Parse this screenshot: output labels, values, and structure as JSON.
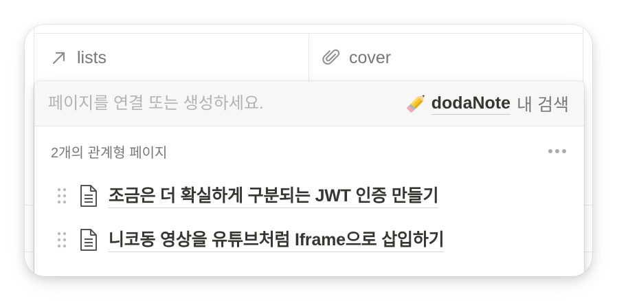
{
  "table": {
    "columns": [
      {
        "icon": "arrow-up-right-icon",
        "label": "lists"
      },
      {
        "icon": "paperclip-icon",
        "label": "cover"
      }
    ]
  },
  "popover": {
    "search": {
      "placeholder": "페이지를 연결 또는 생성하세요.",
      "value": ""
    },
    "scope": {
      "emoji": "pencil-emoji",
      "database": "dodaNote",
      "suffix": "내 검색"
    },
    "section": {
      "title": "2개의 관계형 페이지",
      "more_icon": "more-horizontal-icon"
    },
    "pages": [
      {
        "icon": "document-icon",
        "title": "조금은 더 확실하게 구분되는 JWT 인증 만들기"
      },
      {
        "icon": "document-icon",
        "title": "니코동 영상을 유튜브처럼 Iframe으로 삽입하기"
      }
    ]
  },
  "colors": {
    "text_primary": "#37352f",
    "text_secondary": "#787774",
    "border": "#e9e9e7",
    "search_bg": "#f7f7f5"
  }
}
